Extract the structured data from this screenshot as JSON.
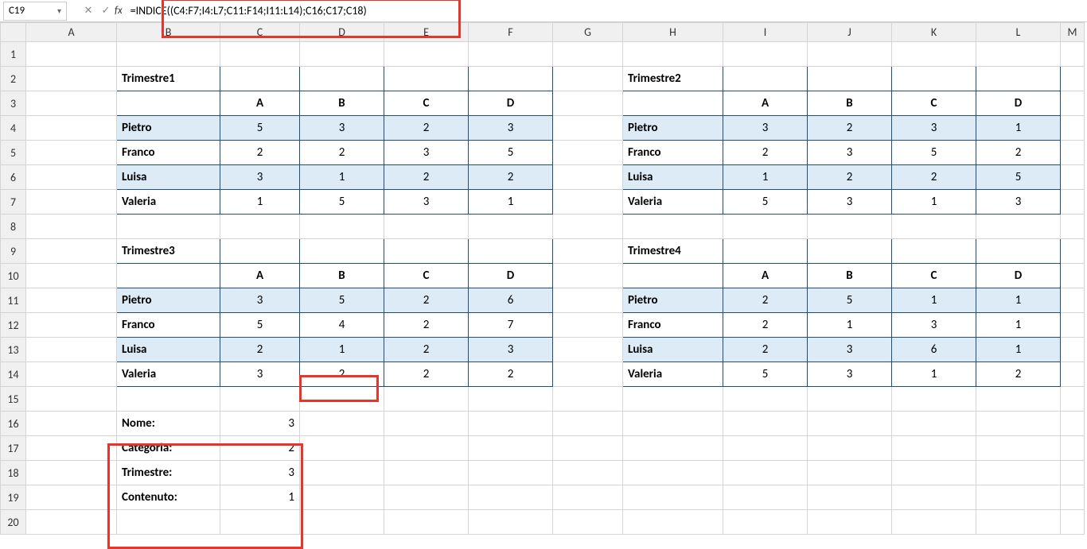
{
  "namebox": "C19",
  "formula": "=INDICE((C4:F7;I4:L7;C11:F14;I11:L14);C16;C17;C18)",
  "columns": [
    "A",
    "B",
    "C",
    "D",
    "E",
    "F",
    "G",
    "H",
    "I",
    "J",
    "K",
    "L",
    "M"
  ],
  "rows": [
    "1",
    "2",
    "3",
    "4",
    "5",
    "6",
    "7",
    "8",
    "9",
    "10",
    "11",
    "12",
    "13",
    "14",
    "15",
    "16",
    "17",
    "18",
    "19",
    "20"
  ],
  "tables": {
    "t1": {
      "title": "Trimestre1",
      "cols": [
        "A",
        "B",
        "C",
        "D"
      ],
      "rows": [
        {
          "name": "Pietro",
          "vals": [
            "5",
            "3",
            "2",
            "3"
          ]
        },
        {
          "name": "Franco",
          "vals": [
            "2",
            "2",
            "3",
            "5"
          ]
        },
        {
          "name": "Luisa",
          "vals": [
            "3",
            "1",
            "2",
            "2"
          ]
        },
        {
          "name": "Valeria",
          "vals": [
            "1",
            "5",
            "3",
            "1"
          ]
        }
      ]
    },
    "t2": {
      "title": "Trimestre2",
      "cols": [
        "A",
        "B",
        "C",
        "D"
      ],
      "rows": [
        {
          "name": "Pietro",
          "vals": [
            "3",
            "2",
            "3",
            "1"
          ]
        },
        {
          "name": "Franco",
          "vals": [
            "2",
            "3",
            "5",
            "2"
          ]
        },
        {
          "name": "Luisa",
          "vals": [
            "1",
            "2",
            "2",
            "5"
          ]
        },
        {
          "name": "Valeria",
          "vals": [
            "5",
            "3",
            "1",
            "3"
          ]
        }
      ]
    },
    "t3": {
      "title": "Trimestre3",
      "cols": [
        "A",
        "B",
        "C",
        "D"
      ],
      "rows": [
        {
          "name": "Pietro",
          "vals": [
            "3",
            "5",
            "2",
            "6"
          ]
        },
        {
          "name": "Franco",
          "vals": [
            "5",
            "4",
            "2",
            "7"
          ]
        },
        {
          "name": "Luisa",
          "vals": [
            "2",
            "1",
            "2",
            "3"
          ]
        },
        {
          "name": "Valeria",
          "vals": [
            "3",
            "2",
            "2",
            "2"
          ]
        }
      ]
    },
    "t4": {
      "title": "Trimestre4",
      "cols": [
        "A",
        "B",
        "C",
        "D"
      ],
      "rows": [
        {
          "name": "Pietro",
          "vals": [
            "2",
            "5",
            "1",
            "1"
          ]
        },
        {
          "name": "Franco",
          "vals": [
            "2",
            "1",
            "3",
            "1"
          ]
        },
        {
          "name": "Luisa",
          "vals": [
            "2",
            "3",
            "6",
            "1"
          ]
        },
        {
          "name": "Valeria",
          "vals": [
            "5",
            "3",
            "1",
            "2"
          ]
        }
      ]
    }
  },
  "lookup": {
    "r0": {
      "label": "Nome:",
      "val": "3"
    },
    "r1": {
      "label": "Categoria:",
      "val": "2"
    },
    "r2": {
      "label": "Trimestre:",
      "val": "3"
    },
    "r3": {
      "label": "Contenuto:",
      "val": "1"
    }
  }
}
